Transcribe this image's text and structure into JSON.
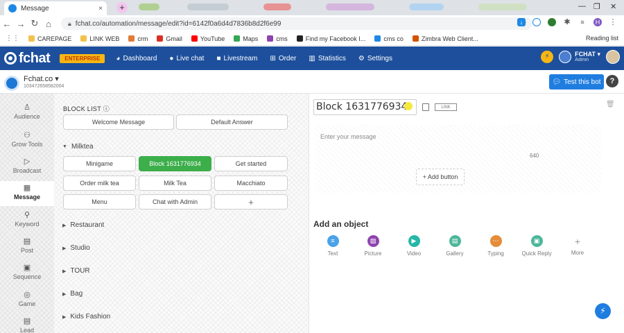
{
  "browser": {
    "tab_title": "Message",
    "tab_close": "×",
    "new_tab": "+",
    "url": "fchat.co/automation/message/edit?id=6142f0a6d4d7836b8d2f6e99",
    "profile_initial": "H",
    "reading_list": "Reading list",
    "bookmarks": [
      {
        "label": "CAREPAGE",
        "color": "#f2c14e"
      },
      {
        "label": "LINK WEB",
        "color": "#f2c14e"
      },
      {
        "label": "crm",
        "color": "#e07b39"
      },
      {
        "label": "Gmail",
        "color": "#d93025"
      },
      {
        "label": "YouTube",
        "color": "#ff0000"
      },
      {
        "label": "Maps",
        "color": "#34a853"
      },
      {
        "label": "cms",
        "color": "#8e44ad"
      },
      {
        "label": "Find my Facebook I...",
        "color": "#222222"
      },
      {
        "label": "cms co",
        "color": "#1e88e5"
      },
      {
        "label": "Zimbra Web Client...",
        "color": "#d35400"
      }
    ]
  },
  "app": {
    "logo_text": "fchat",
    "plan_badge": "ENTERPRISE",
    "menu": [
      {
        "label": "Dashboard",
        "icon": "dashboard-icon",
        "glyph": "◕"
      },
      {
        "label": "Live chat",
        "icon": "chat-icon",
        "glyph": "●"
      },
      {
        "label": "Livestream",
        "icon": "video-icon",
        "glyph": "■"
      },
      {
        "label": "Order",
        "icon": "cart-icon",
        "glyph": "⊞"
      },
      {
        "label": "Statistics",
        "icon": "chart-icon",
        "glyph": "▥"
      },
      {
        "label": "Settings",
        "icon": "gear-icon",
        "glyph": "⚙"
      }
    ],
    "account_name": "FCHAT ▾",
    "account_role": "Admin"
  },
  "page": {
    "name": "Fchat.co ▾",
    "page_id": "103472658582004",
    "test_bot": "Test this bot",
    "help": "?"
  },
  "sidebar": [
    {
      "label": "Audience",
      "icon": "user-icon",
      "glyph": "♙"
    },
    {
      "label": "Grow Tools",
      "icon": "grow-icon",
      "glyph": "⚇"
    },
    {
      "label": "Broadcast",
      "icon": "broadcast-icon",
      "glyph": "▷"
    },
    {
      "label": "Message",
      "icon": "message-icon",
      "glyph": "▦",
      "active": true
    },
    {
      "label": "Keyword",
      "icon": "key-icon",
      "glyph": "⚲"
    },
    {
      "label": "Post",
      "icon": "post-icon",
      "glyph": "▤"
    },
    {
      "label": "Sequence",
      "icon": "sequence-icon",
      "glyph": "▣"
    },
    {
      "label": "Game",
      "icon": "game-icon",
      "glyph": "◎"
    },
    {
      "label": "Lead",
      "icon": "lead-icon",
      "glyph": "▤"
    }
  ],
  "block_list": {
    "title": "BLOCK LIST ⓘ",
    "top_blocks": [
      "Welcome Message",
      "Default Answer"
    ],
    "group_name": "Milktea",
    "group_blocks": [
      "Minigame",
      "Block 1631776934",
      "Get started",
      "Order milk tea",
      "Milk Tea",
      "Macchiato",
      "Menu",
      "Chat with Admin",
      "+"
    ],
    "collapsed_groups": [
      "Restaurant",
      "Studio",
      "TOUR",
      "Bag",
      "Kids Fashion"
    ]
  },
  "editor": {
    "block_name": "Block 1631776934",
    "link_label": "LINK",
    "message_placeholder": "Enter your message",
    "char_counter": "640",
    "add_button": "+ Add button",
    "add_object_title": "Add an object",
    "objects": [
      {
        "label": "Text",
        "icon": "text-icon",
        "color": "#4aa3e8",
        "glyph": "≡"
      },
      {
        "label": "Picture",
        "icon": "picture-icon",
        "color": "#8e44ad",
        "glyph": "▨"
      },
      {
        "label": "Video",
        "icon": "video-icon",
        "color": "#27b7a8",
        "glyph": "▶"
      },
      {
        "label": "Gallery",
        "icon": "gallery-icon",
        "color": "#4db69a",
        "glyph": "▤"
      },
      {
        "label": "Typing",
        "icon": "typing-icon",
        "color": "#e58c3a",
        "glyph": "⋯"
      },
      {
        "label": "Quick Reply",
        "icon": "quick-reply-icon",
        "color": "#4db69a",
        "glyph": "▣"
      },
      {
        "label": "More",
        "icon": "plus-icon",
        "color": "#999999",
        "glyph": "+"
      }
    ]
  },
  "colors": {
    "header_blue": "#1d4f9c",
    "accent_blue": "#1f7de0",
    "active_green": "#3cae4a",
    "enterprise_yellow": "#f7b614"
  }
}
